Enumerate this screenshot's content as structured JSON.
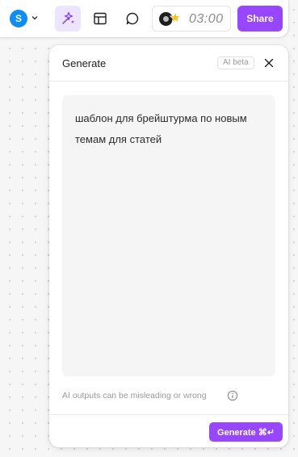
{
  "toolbar": {
    "avatar_initial": "S",
    "avatar_color": "#0d8ef7",
    "ai_tool_icon": "sparkle-wand-icon",
    "layout_tool_icon": "layout-icon",
    "comment_tool_icon": "comment-icon",
    "timer_value": "03:00",
    "share_label": "Share",
    "accent_color": "#9747ff"
  },
  "panel": {
    "title": "Generate",
    "beta_badge": "AI beta",
    "prompt_text": "шаблон для брейштурма по новым темам для статей",
    "disclaimer": "AI outputs can be misleading or wrong",
    "generate_label": "Generate ⌘↵"
  }
}
